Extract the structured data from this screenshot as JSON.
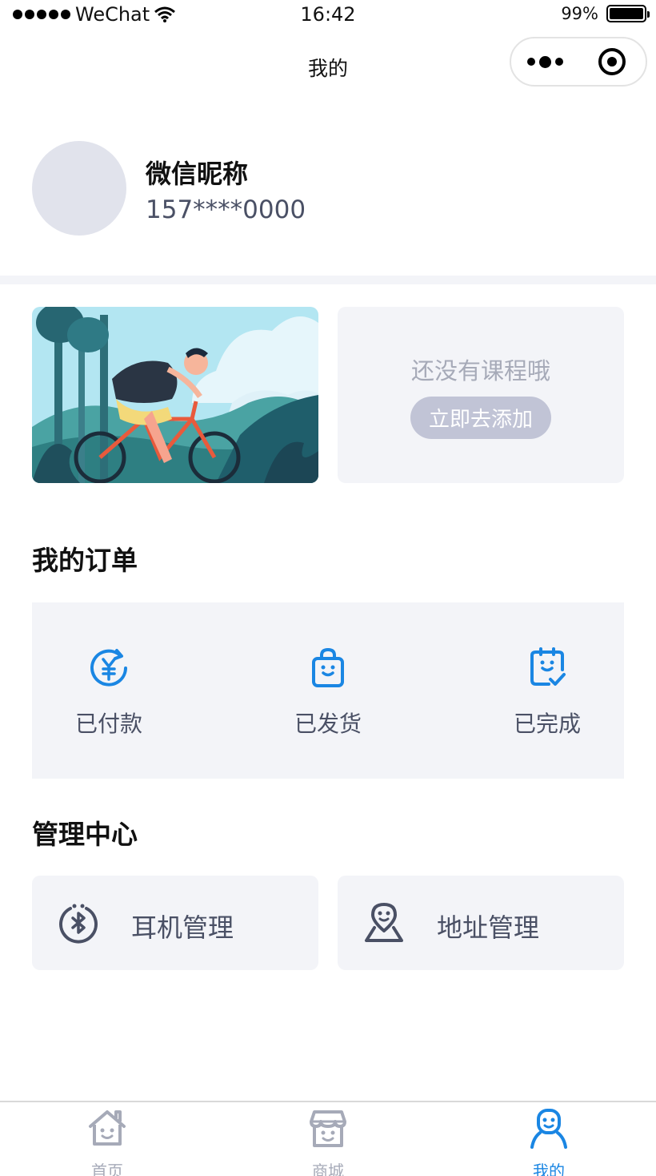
{
  "status_bar": {
    "carrier": "WeChat",
    "time": "16:42",
    "battery_percent": "99%",
    "battery_level": 0.99
  },
  "nav": {
    "title": "我的"
  },
  "profile": {
    "nickname": "微信昵称",
    "phone": "157****0000"
  },
  "course": {
    "empty_text": "还没有课程哦",
    "add_button": "立即去添加"
  },
  "orders": {
    "title": "我的订单",
    "items": [
      {
        "label": "已付款",
        "icon": "yuan-refresh-icon"
      },
      {
        "label": "已发货",
        "icon": "shopping-bag-icon"
      },
      {
        "label": "已完成",
        "icon": "clipboard-check-icon"
      }
    ]
  },
  "management": {
    "title": "管理中心",
    "items": [
      {
        "label": "耳机管理",
        "icon": "bluetooth-icon"
      },
      {
        "label": "地址管理",
        "icon": "location-pin-icon"
      }
    ]
  },
  "tab_bar": {
    "items": [
      {
        "label": "首页",
        "icon": "home-icon",
        "active": false
      },
      {
        "label": "商城",
        "icon": "store-icon",
        "active": false
      },
      {
        "label": "我的",
        "icon": "person-icon",
        "active": true
      }
    ]
  },
  "colors": {
    "accent_blue": "#1a86e3",
    "panel_bg": "#f3f4f8",
    "muted_text": "#a6aab8",
    "body_text": "#4a5065",
    "button_bg": "#c1c4d6"
  }
}
